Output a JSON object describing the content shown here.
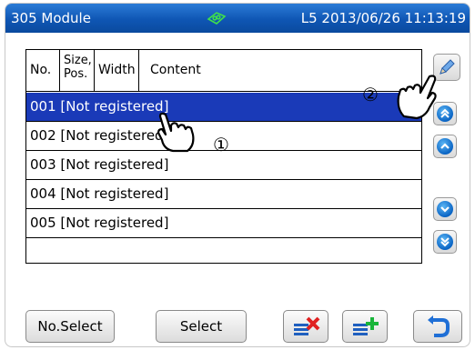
{
  "titlebar": {
    "left_label": "305 Module",
    "right_label": "L5 2013/06/26 11:13:19",
    "icon": "tape-cassette-icon"
  },
  "table": {
    "headers": {
      "no": "No.",
      "size_line1": "Size,",
      "size_line2": "Pos.",
      "width": "Width",
      "content": "Content"
    },
    "rows": [
      {
        "text": "001 [Not registered]",
        "selected": true
      },
      {
        "text": "002 [Not registered]",
        "selected": false
      },
      {
        "text": "003 [Not registered]",
        "selected": false
      },
      {
        "text": "004 [Not registered]",
        "selected": false
      },
      {
        "text": "005 [Not registered]",
        "selected": false
      }
    ]
  },
  "side_buttons": {
    "edit": "pencil-icon",
    "page_up": "double-chevron-up-icon",
    "up": "chevron-up-icon",
    "down": "chevron-down-icon",
    "page_down": "double-chevron-down-icon"
  },
  "bottom": {
    "no_select_label": "No.Select",
    "select_label": "Select",
    "delete_icon": "delete-list-icon",
    "add_icon": "add-list-icon",
    "back_icon": "return-arrow-icon"
  },
  "annotations": {
    "step1": "①",
    "step2": "②"
  },
  "colors": {
    "titlebar": "#0f56b4",
    "selected_row": "#1a3ab8",
    "button_blue": "#0a64c4"
  }
}
